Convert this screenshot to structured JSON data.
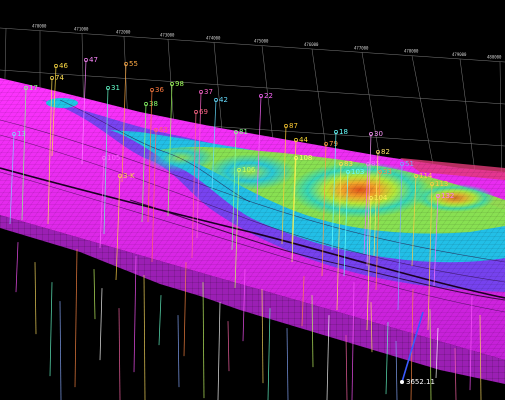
{
  "viewer": {
    "axis_ticks": [
      "470000",
      "471000",
      "472000",
      "473000",
      "474000",
      "475000",
      "476000",
      "477000",
      "478000",
      "479000",
      "480000"
    ],
    "depth_readout": "3652.11",
    "colors": {
      "background": "#000000",
      "surface_low": "#d22be6",
      "surface_mid1": "#6a4cf0",
      "surface_mid2": "#18c8e0",
      "surface_mid3": "#8fe640",
      "surface_high": "#f07a1a",
      "grid": "#9a9a9a"
    },
    "wells": [
      {
        "label": "105",
        "color": "#ff66ff"
      },
      {
        "label": "3-K",
        "color": "#ffd24a"
      },
      {
        "label": "106",
        "color": "#c8ff5a"
      },
      {
        "label": "79",
        "color": "#ff9a40"
      },
      {
        "label": "83",
        "color": "#ffdd55"
      },
      {
        "label": "85",
        "color": "#ff66ff"
      },
      {
        "label": "82",
        "color": "#ffe066"
      },
      {
        "label": "33",
        "color": "#ff8844"
      },
      {
        "label": "104",
        "color": "#ffee55"
      },
      {
        "label": "113",
        "color": "#ffcc44"
      },
      {
        "label": "132",
        "color": "#ff77ff"
      },
      {
        "label": "103",
        "color": "#66ffff"
      },
      {
        "label": "38",
        "color": "#8cff6a"
      },
      {
        "label": "36",
        "color": "#ff7a40"
      },
      {
        "label": "37",
        "color": "#ff66cc"
      },
      {
        "label": "13",
        "color": "#88ccff"
      },
      {
        "label": "44",
        "color": "#ffdd33"
      },
      {
        "label": "81",
        "color": "#8cff8c"
      },
      {
        "label": "63",
        "color": "#ff6666"
      },
      {
        "label": "31",
        "color": "#66ffcc"
      },
      {
        "label": "46",
        "color": "#ffdd44"
      },
      {
        "label": "47",
        "color": "#ff88ff"
      },
      {
        "label": "55",
        "color": "#ffaa44"
      },
      {
        "label": "98",
        "color": "#9fff5a"
      },
      {
        "label": "74",
        "color": "#ffe055"
      },
      {
        "label": "42",
        "color": "#66ddff"
      },
      {
        "label": "22",
        "color": "#ff66ff"
      },
      {
        "label": "87",
        "color": "#ffcc33"
      },
      {
        "label": "17",
        "color": "#88ff88"
      },
      {
        "label": "69",
        "color": "#ff6688"
      },
      {
        "label": "114",
        "color": "#ffcc44"
      },
      {
        "label": "108",
        "color": "#ffff66"
      },
      {
        "label": "18",
        "color": "#66ffff"
      },
      {
        "label": "30",
        "color": "#ff99ff"
      },
      {
        "label": "51",
        "color": "#7aa8ff"
      }
    ]
  }
}
